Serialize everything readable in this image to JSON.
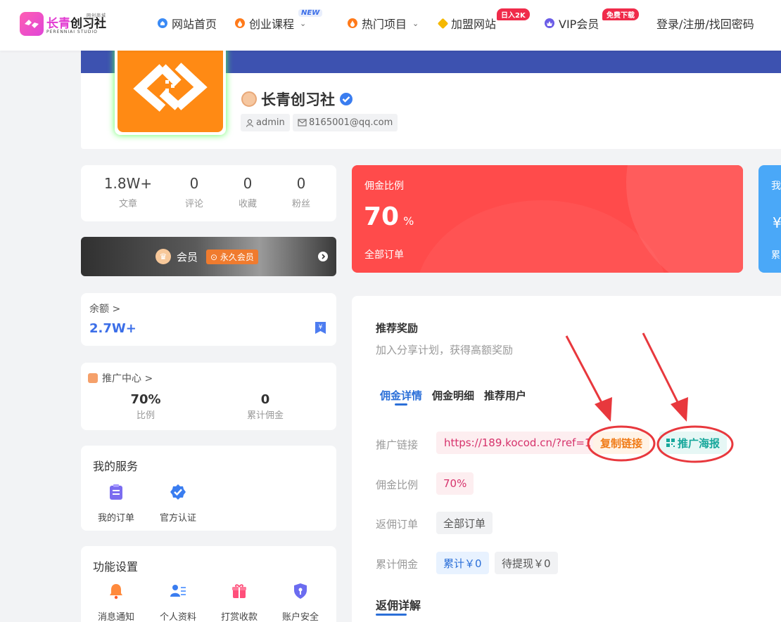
{
  "brand": {
    "small": "网创商城",
    "name_a": "长青",
    "name_b": "创习社",
    "en": "PERENNIAI STUDIO"
  },
  "nav": {
    "home": "网站首页",
    "courses": "创业课程",
    "courses_badge": "NEW",
    "projects": "热门项目",
    "join": "加盟网站",
    "join_badge": "日入2K",
    "vip": "VIP会员",
    "vip_badge": "免费下载",
    "login": "登录/注册/找回密码"
  },
  "profile": {
    "name": "长青创习社",
    "user_tag": "admin",
    "email_tag": "8165001@qq.com"
  },
  "stats": [
    {
      "value": "1.8W+",
      "label": "文章"
    },
    {
      "value": "0",
      "label": "评论"
    },
    {
      "value": "0",
      "label": "收藏"
    },
    {
      "value": "0",
      "label": "粉丝"
    }
  ],
  "member": {
    "label": "会员",
    "badge": "永久会员"
  },
  "balance": {
    "label": "余额 >",
    "value": "2.7W+"
  },
  "promo": {
    "title": "推广中心 >",
    "ratio_value": "70%",
    "ratio_label": "比例",
    "total_value": "0",
    "total_label": "累计佣金"
  },
  "services": {
    "title": "我的服务",
    "items": [
      {
        "label": "我的订单",
        "icon": "clipboard-icon"
      },
      {
        "label": "官方认证",
        "icon": "verified-badge-icon"
      }
    ]
  },
  "settings": {
    "title": "功能设置",
    "items": [
      {
        "label": "消息通知",
        "icon": "bell-icon"
      },
      {
        "label": "个人资料",
        "icon": "user-card-icon"
      },
      {
        "label": "打赏收款",
        "icon": "gift-icon"
      },
      {
        "label": "账户安全",
        "icon": "shield-icon"
      }
    ]
  },
  "commission_card": {
    "title": "佣金比例",
    "value": "70",
    "unit": "%",
    "footer": "全部订单"
  },
  "blue_card": {
    "t1": "我",
    "t2": "¥",
    "t3": "累"
  },
  "referral": {
    "title": "推荐奖励",
    "subtitle": "加入分享计划，获得高额奖励",
    "tabs": [
      "佣金详情",
      "佣金明细",
      "推荐用户"
    ],
    "link_label": "推广链接",
    "link_value": "https://189.kocod.cn/?ref=1",
    "copy_btn": "复制链接",
    "poster_btn": "推广海报",
    "ratio_label": "佣金比例",
    "ratio_value": "70%",
    "order_label": "返佣订单",
    "order_value": "全部订单",
    "total_label": "累计佣金",
    "total_value": "累计￥0",
    "pending_value": "待提现￥0",
    "detail_title": "返佣详解"
  },
  "colors": {
    "accent": "#3d52b0",
    "red": "#ff4b4b",
    "orange": "#ff8a14",
    "annotation": "#e8383d"
  }
}
